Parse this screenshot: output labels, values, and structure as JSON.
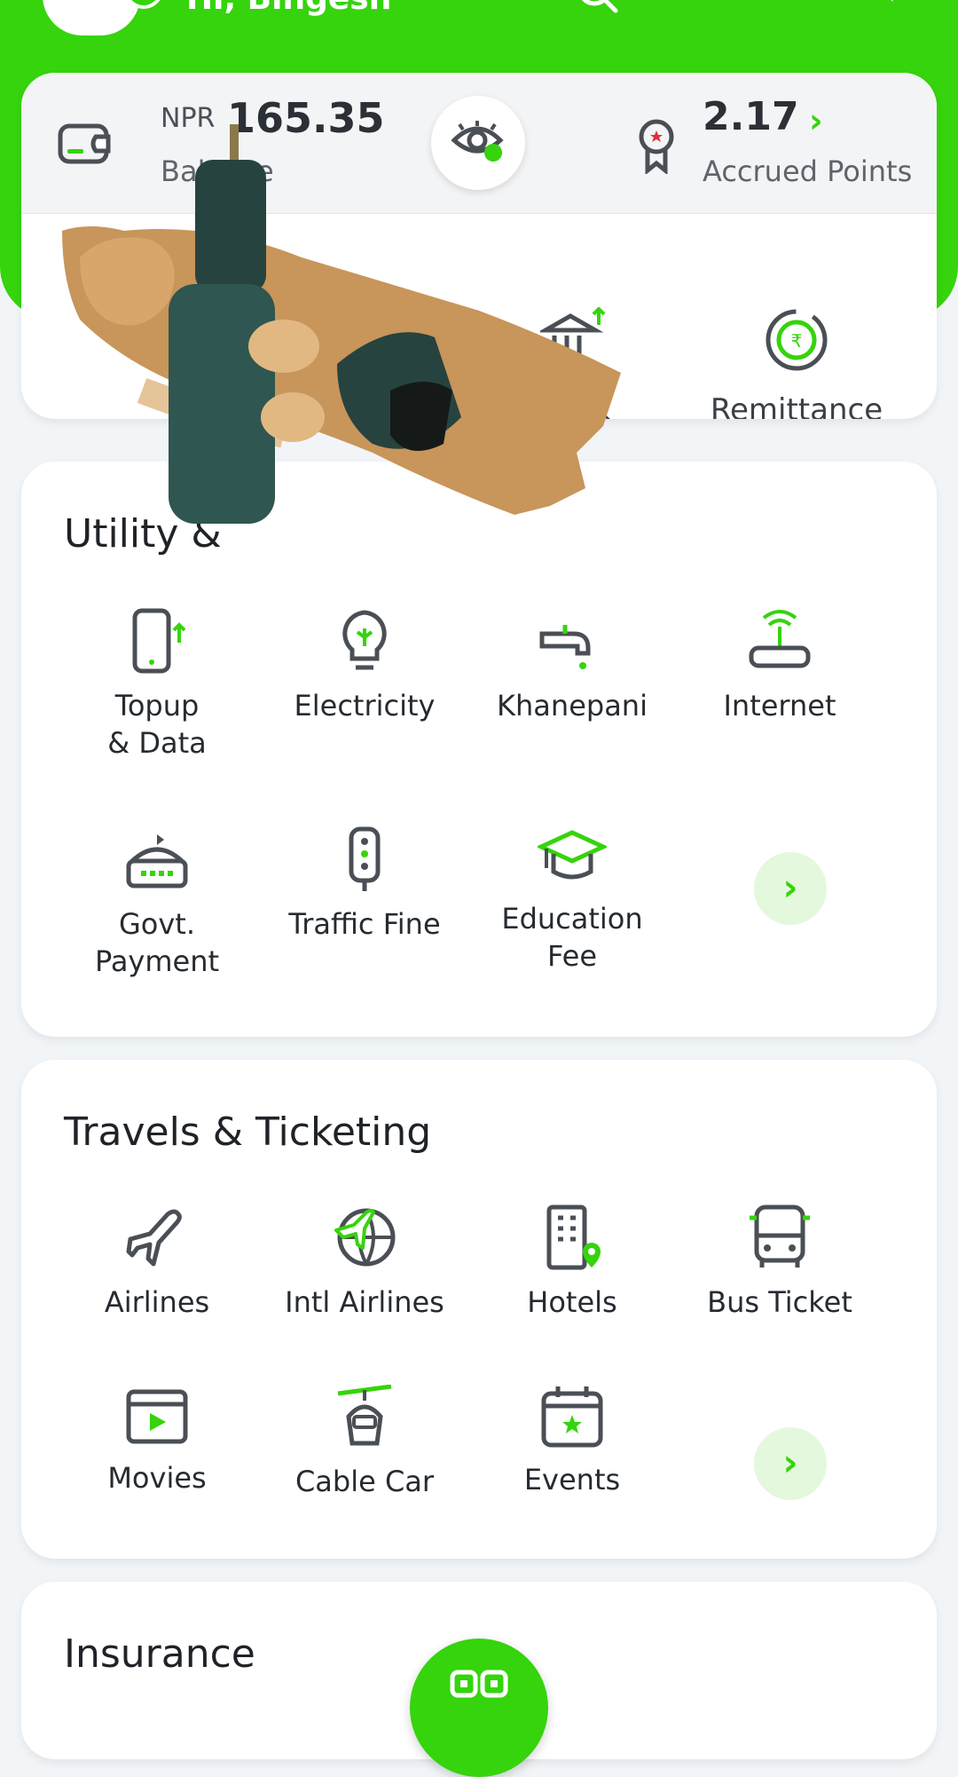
{
  "header": {
    "greeting": "Hi, Bingesh"
  },
  "wallet": {
    "currency": "NPR",
    "balance": "165.35",
    "balance_label": "Balance",
    "points_value": "2.17",
    "points_label": "Accrued Points"
  },
  "quick_actions": [
    {
      "label": ""
    },
    {
      "label": ""
    },
    {
      "label": "Bank"
    },
    {
      "label": "Remittance"
    }
  ],
  "utility": {
    "title_visible": "Utility &",
    "items": [
      {
        "label": "Topup\n& Data"
      },
      {
        "label": "Electricity"
      },
      {
        "label": "Khanepani"
      },
      {
        "label": "Internet"
      },
      {
        "label": "Govt.\nPayment"
      },
      {
        "label": "Traffic Fine"
      },
      {
        "label": "Education\nFee"
      }
    ]
  },
  "travel": {
    "title": "Travels & Ticketing",
    "items": [
      {
        "label": "Airlines"
      },
      {
        "label": "Intl Airlines"
      },
      {
        "label": "Hotels"
      },
      {
        "label": "Bus Ticket"
      },
      {
        "label": "Movies"
      },
      {
        "label": "Cable Car"
      },
      {
        "label": "Events"
      }
    ]
  },
  "insurance": {
    "title": "Insurance"
  },
  "colors": {
    "brand": "#35d40c",
    "icon_gray": "#4a4f56",
    "card": "#ffffff"
  },
  "icons": [
    "search-icon",
    "bell-icon",
    "chat-icon",
    "wallet-icon",
    "eye-icon",
    "ribbon-icon",
    "bank-icon",
    "remittance-icon",
    "phone-topup-icon",
    "bulb-icon",
    "tap-icon",
    "router-icon",
    "govt-building-icon",
    "traffic-light-icon",
    "graduation-cap-icon",
    "plane-icon",
    "globe-plane-icon",
    "hotel-icon",
    "bus-icon",
    "clapper-icon",
    "cable-car-icon",
    "calendar-star-icon",
    "qr-scan-icon"
  ]
}
